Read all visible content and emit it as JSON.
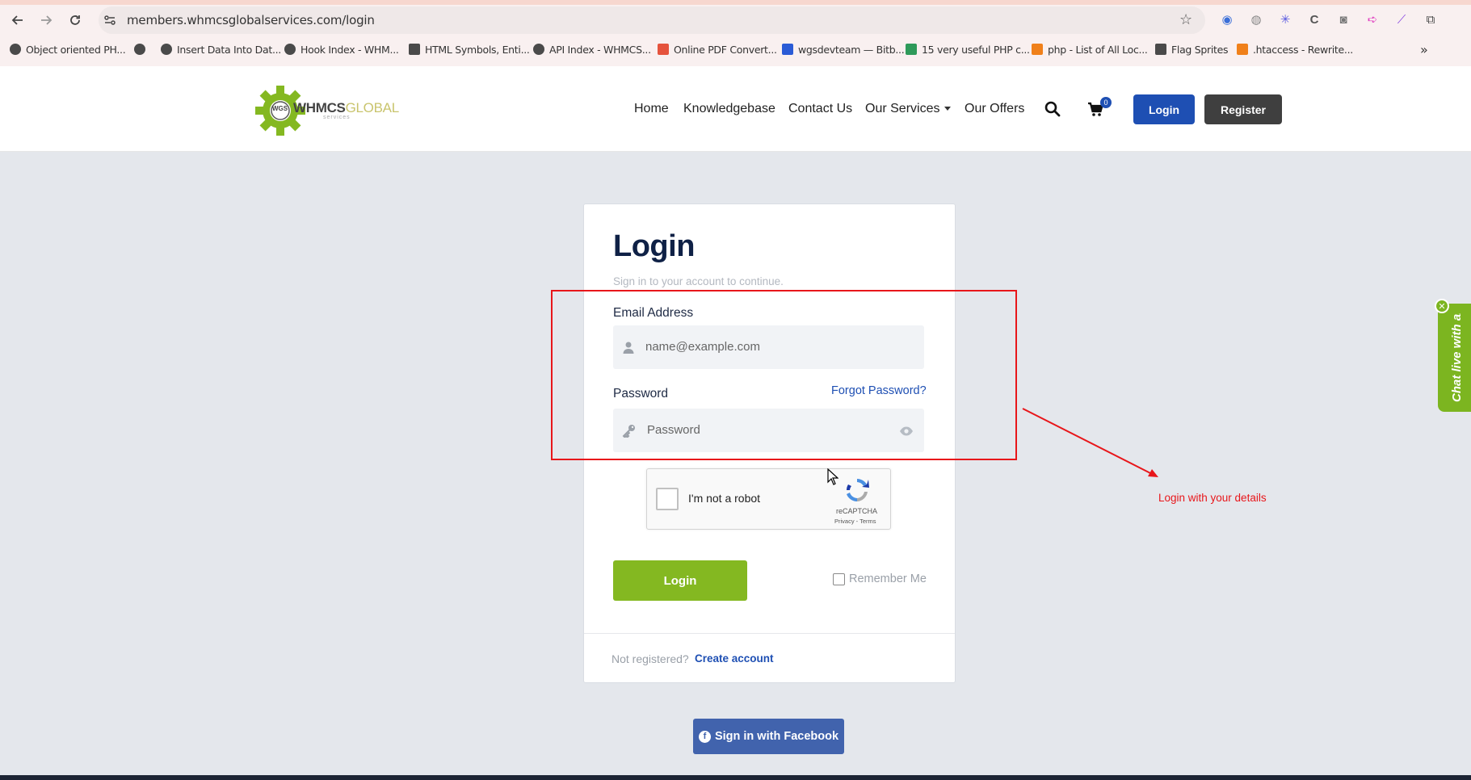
{
  "browser": {
    "url": "members.whmcsglobalservices.com/login",
    "bookmarks": [
      {
        "label": "Object oriented PH..."
      },
      {
        "label": ""
      },
      {
        "label": "Insert Data Into Dat..."
      },
      {
        "label": "Hook Index - WHM..."
      },
      {
        "label": "HTML Symbols, Enti..."
      },
      {
        "label": "API Index - WHMCS..."
      },
      {
        "label": "Online PDF Convert..."
      },
      {
        "label": "wgsdevteam — Bitb..."
      },
      {
        "label": "15 very useful PHP c..."
      },
      {
        "label": "php - List of All Loc..."
      },
      {
        "label": "Flag Sprites"
      },
      {
        "label": ".htaccess - Rewrite..."
      }
    ]
  },
  "header": {
    "logo_main": "WHMCS",
    "logo_accent": "GLOBAL",
    "logo_sub": "services",
    "logo_badge": "WGS",
    "menu": {
      "home": "Home",
      "knowledgebase": "Knowledgebase",
      "contact": "Contact Us",
      "services": "Our Services",
      "offers": "Our Offers"
    },
    "cart_count": "0",
    "login_label": "Login",
    "register_label": "Register"
  },
  "login": {
    "title": "Login",
    "subtitle": "Sign in to your account to continue.",
    "email_label": "Email Address",
    "email_placeholder": "name@example.com",
    "password_label": "Password",
    "password_placeholder": "Password",
    "forgot_label": "Forgot Password?",
    "captcha_label": "I'm not a robot",
    "captcha_brand": "reCAPTCHA",
    "captcha_terms": "Privacy - Terms",
    "submit_label": "Login",
    "remember_label": "Remember Me",
    "not_registered": "Not registered?",
    "create_account": "Create account",
    "facebook_label": "Sign in with Facebook"
  },
  "annotation": {
    "text": "Login with your details",
    "color": "#e8161a"
  },
  "chat": {
    "text": "Chat live with an",
    "close": "✕"
  },
  "colors": {
    "brand_blue": "#1e4fb3",
    "brand_green": "#84b821",
    "facebook": "#4163ad"
  }
}
